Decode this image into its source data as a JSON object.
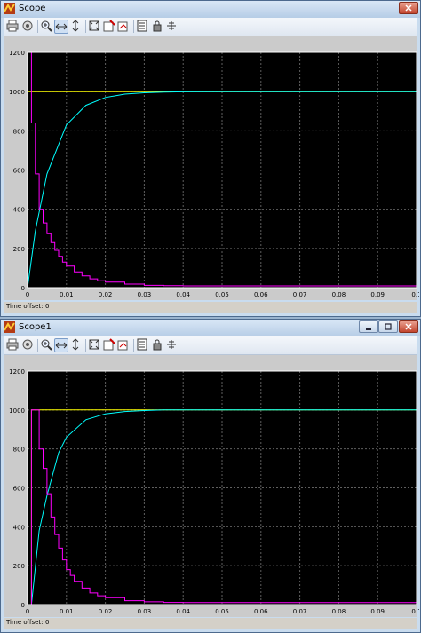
{
  "windows": [
    {
      "title": "Scope",
      "status": {
        "label": "Time offset:",
        "value": "0"
      },
      "chart_data": {
        "type": "line",
        "title": "",
        "xlabel": "",
        "ylabel": "",
        "xlim": [
          0,
          0.1
        ],
        "ylim": [
          0,
          1200
        ],
        "xticks": [
          "0",
          "0.01",
          "0.02",
          "0.03",
          "0.04",
          "0.05",
          "0.06",
          "0.07",
          "0.08",
          "0.09",
          "0.1"
        ],
        "yticks": [
          "0",
          "200",
          "400",
          "600",
          "800",
          "1000",
          "1200"
        ],
        "grid": true,
        "colors": {
          "background": "#000000",
          "grid": "#5f5f5f",
          "series": [
            "#ffff00",
            "#00ffff",
            "#ff00ff"
          ]
        },
        "series": [
          {
            "kind": "step",
            "values": [
              [
                0,
                0
              ],
              [
                0.0001,
                1000
              ],
              [
                0.1,
                1000
              ]
            ]
          },
          {
            "kind": "line",
            "values": [
              [
                0,
                0
              ],
              [
                0.002,
                290
              ],
              [
                0.005,
                580
              ],
              [
                0.01,
                830
              ],
              [
                0.015,
                930
              ],
              [
                0.02,
                970
              ],
              [
                0.025,
                987
              ],
              [
                0.03,
                994
              ],
              [
                0.035,
                997
              ],
              [
                0.04,
                999
              ],
              [
                0.05,
                1000
              ],
              [
                0.1,
                1000
              ]
            ]
          },
          {
            "kind": "step",
            "values": [
              [
                0,
                1200
              ],
              [
                0.001,
                840
              ],
              [
                0.002,
                580
              ],
              [
                0.003,
                400
              ],
              [
                0.004,
                330
              ],
              [
                0.005,
                275
              ],
              [
                0.006,
                230
              ],
              [
                0.007,
                190
              ],
              [
                0.008,
                160
              ],
              [
                0.009,
                130
              ],
              [
                0.01,
                110
              ],
              [
                0.012,
                80
              ],
              [
                0.014,
                60
              ],
              [
                0.016,
                45
              ],
              [
                0.018,
                35
              ],
              [
                0.02,
                28
              ],
              [
                0.025,
                18
              ],
              [
                0.03,
                12
              ],
              [
                0.035,
                10
              ],
              [
                0.04,
                9
              ],
              [
                0.1,
                8
              ]
            ]
          }
        ]
      }
    },
    {
      "title": "Scope1",
      "status": {
        "label": "Time offset:",
        "value": "0"
      },
      "chart_data": {
        "type": "line",
        "title": "",
        "xlabel": "",
        "ylabel": "",
        "xlim": [
          0,
          0.1
        ],
        "ylim": [
          0,
          1200
        ],
        "xticks": [
          "0",
          "0.01",
          "0.02",
          "0.03",
          "0.04",
          "0.05",
          "0.06",
          "0.07",
          "0.08",
          "0.09",
          "0.1"
        ],
        "yticks": [
          "0",
          "200",
          "400",
          "600",
          "800",
          "1000",
          "1200"
        ],
        "grid": true,
        "colors": {
          "background": "#000000",
          "grid": "#5f5f5f",
          "series": [
            "#ffff00",
            "#00ffff",
            "#ff00ff"
          ]
        },
        "series": [
          {
            "kind": "step",
            "values": [
              [
                0,
                0
              ],
              [
                0.001,
                1000
              ],
              [
                0.1,
                1000
              ]
            ]
          },
          {
            "kind": "line",
            "values": [
              [
                0,
                0
              ],
              [
                0.001,
                0
              ],
              [
                0.003,
                380
              ],
              [
                0.005,
                560
              ],
              [
                0.008,
                780
              ],
              [
                0.01,
                860
              ],
              [
                0.015,
                950
              ],
              [
                0.02,
                980
              ],
              [
                0.025,
                992
              ],
              [
                0.03,
                997
              ],
              [
                0.035,
                1000
              ],
              [
                0.1,
                1000
              ]
            ]
          },
          {
            "kind": "step",
            "values": [
              [
                0,
                0
              ],
              [
                0.001,
                1000
              ],
              [
                0.002,
                1000
              ],
              [
                0.003,
                800
              ],
              [
                0.004,
                700
              ],
              [
                0.005,
                570
              ],
              [
                0.006,
                450
              ],
              [
                0.007,
                360
              ],
              [
                0.008,
                290
              ],
              [
                0.009,
                230
              ],
              [
                0.01,
                180
              ],
              [
                0.011,
                150
              ],
              [
                0.012,
                120
              ],
              [
                0.014,
                85
              ],
              [
                0.016,
                60
              ],
              [
                0.018,
                45
              ],
              [
                0.02,
                35
              ],
              [
                0.025,
                20
              ],
              [
                0.03,
                14
              ],
              [
                0.035,
                11
              ],
              [
                0.04,
                10
              ],
              [
                0.1,
                9
              ]
            ]
          }
        ]
      }
    }
  ],
  "toolbar_icons": [
    "print-icon",
    "parameters-icon",
    "zoom-in-icon",
    "zoom-x-icon",
    "zoom-y-icon",
    "autoscale-icon",
    "save-axes-icon",
    "restore-axes-icon",
    "floating-scope-icon",
    "lock-axes-icon",
    "signal-selection-icon"
  ],
  "window_controls": [
    "minimize-icon",
    "maximize-icon",
    "close-icon"
  ]
}
